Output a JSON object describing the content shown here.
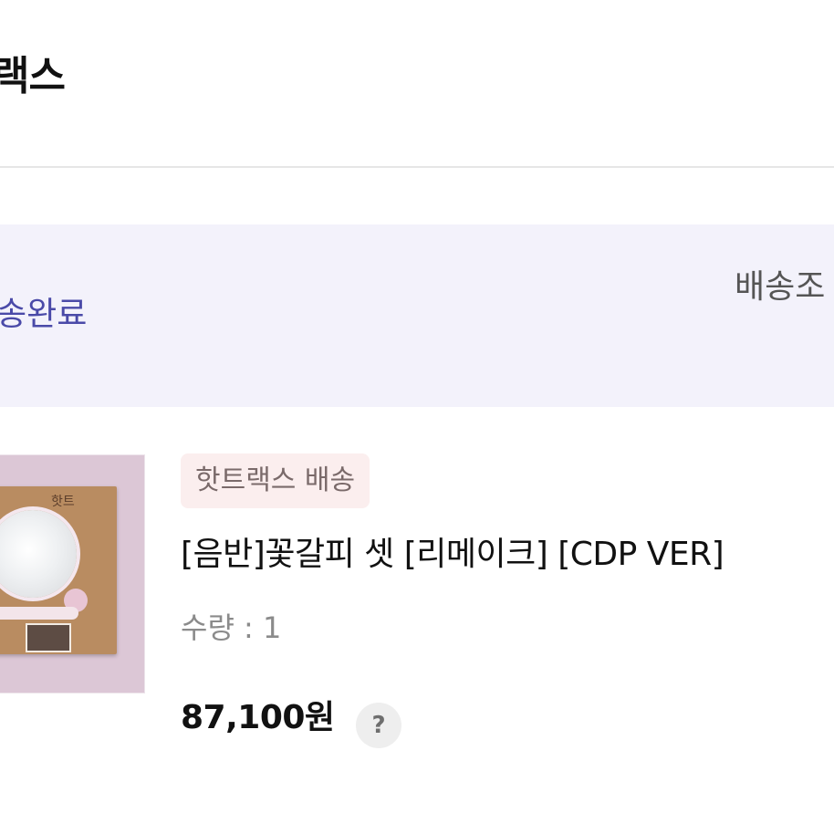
{
  "header": {
    "title": "랙스"
  },
  "delivery": {
    "status": "송완료",
    "action_label": "배송조"
  },
  "product": {
    "thumbnail_icon": "album-thumbnail",
    "album_logo_text": "핫트",
    "badge": "핫트랙스 배송",
    "name": "[음반]꽃갈피 셋 [리메이크] [CDP VER]",
    "quantity": "수량 : 1",
    "price": "87,100원",
    "help_label": "?"
  },
  "colors": {
    "status_panel_bg": "#f3f2fb",
    "status_text": "#4a4aa8",
    "badge_bg": "#fbeeee"
  }
}
